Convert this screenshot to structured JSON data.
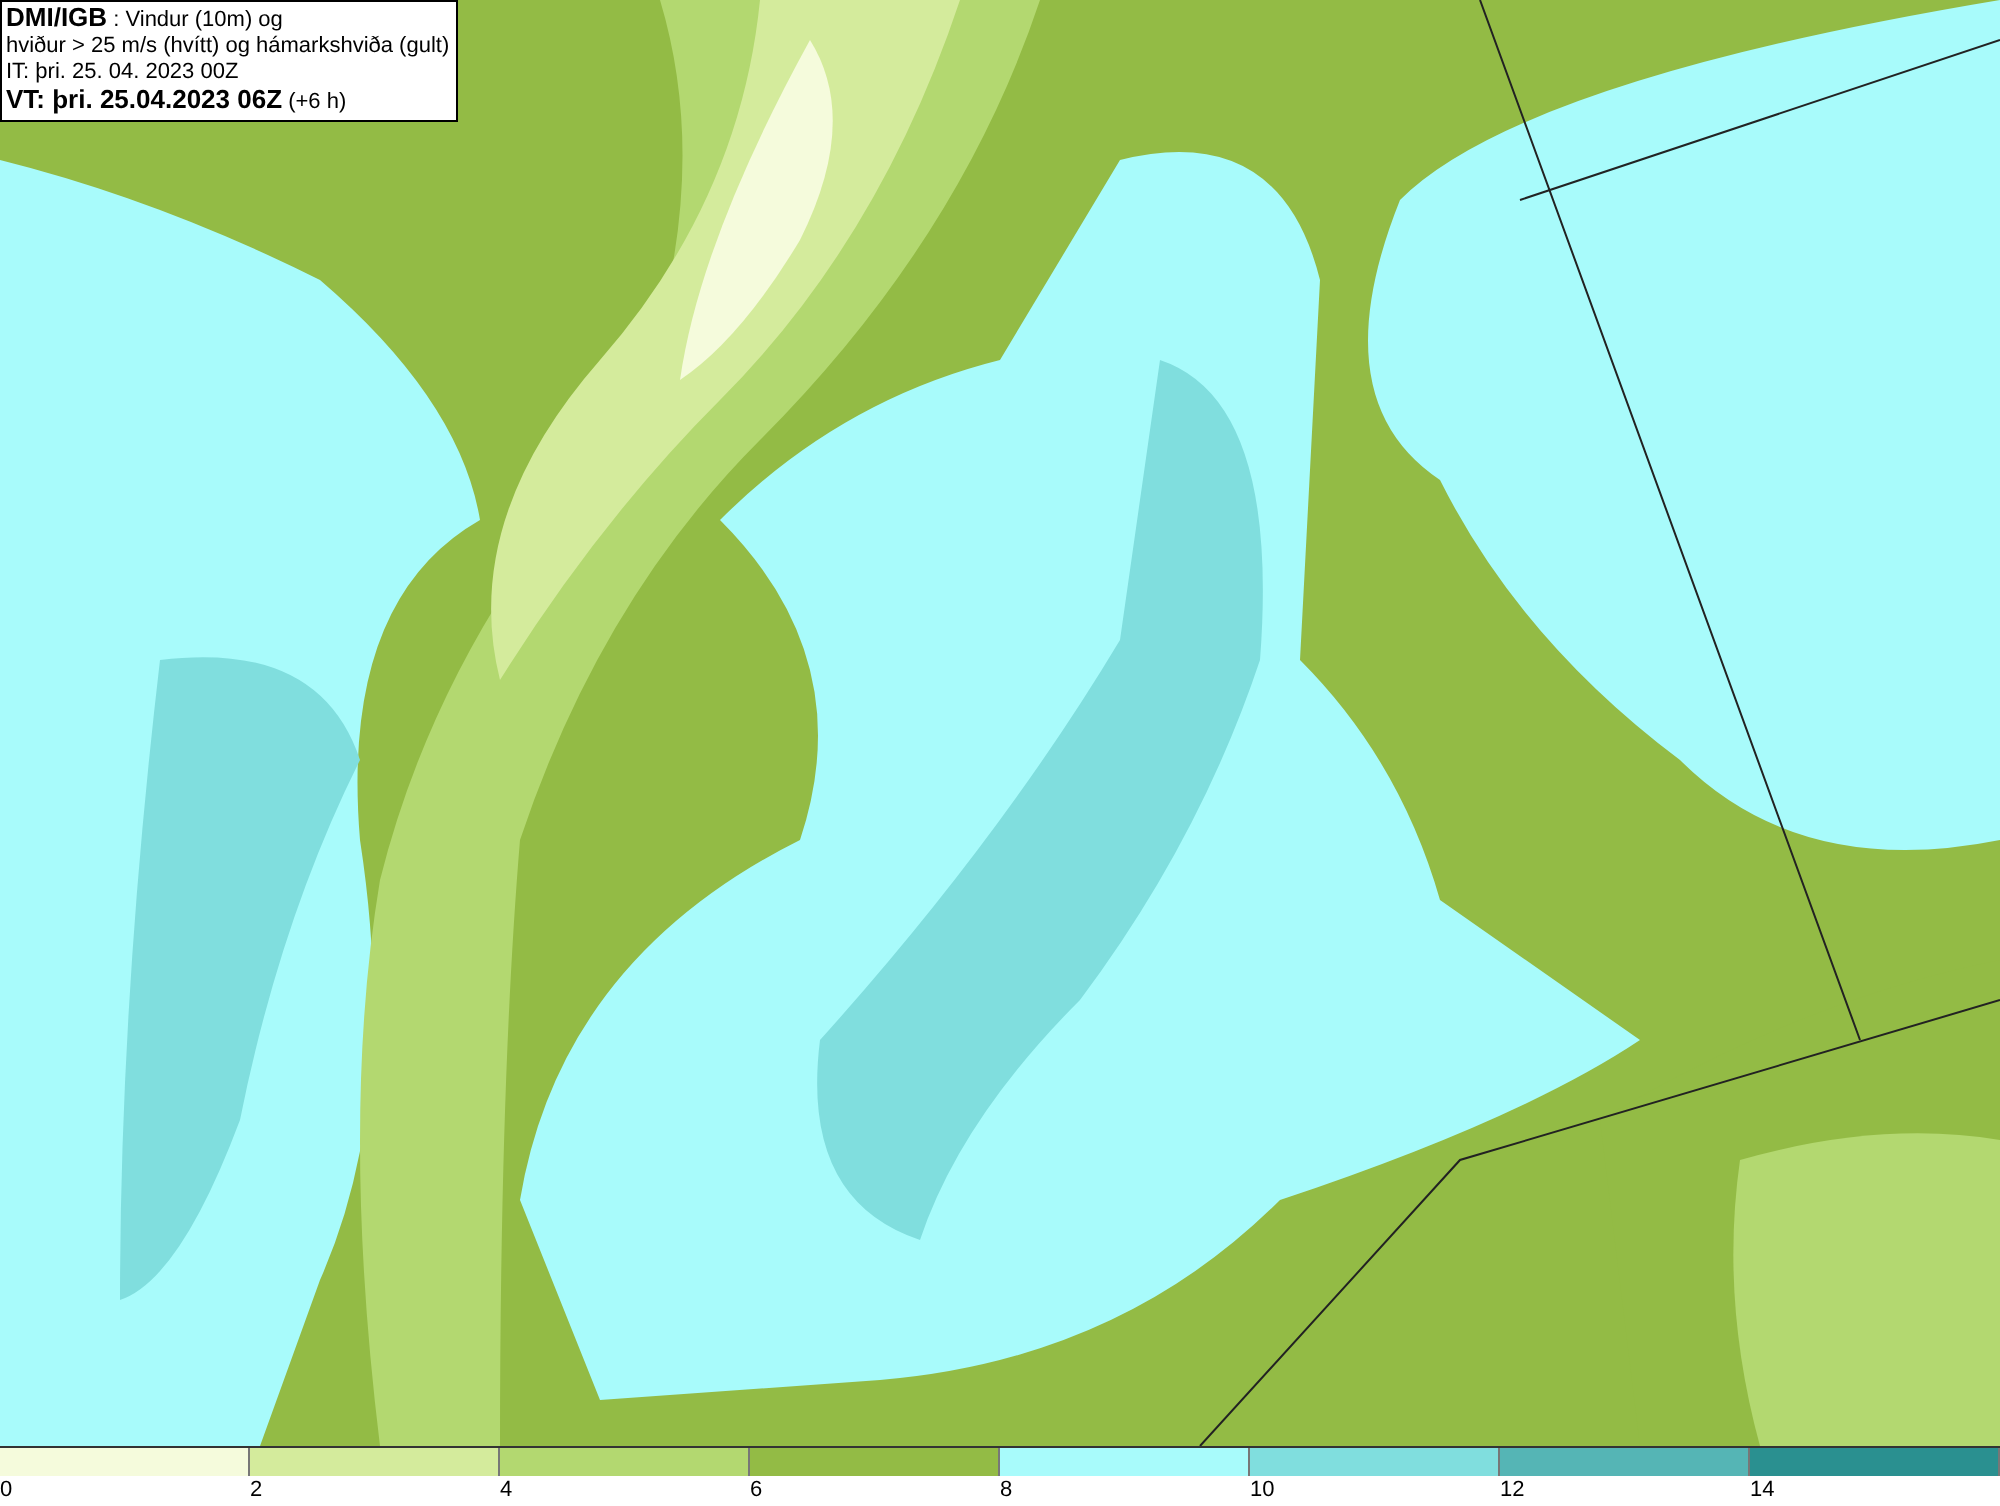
{
  "title_box": {
    "lines": [
      "**DMI/IGB** : Vindur (10m) og",
      "hviður > 25 m/s (hvítt) og hámarkshviða (gult)",
      "IT: þri. 25. 04. 2023 00Z",
      "**VT: þri. 25.04.2023 06Z** (+6 h)"
    ]
  },
  "legend": [
    {
      "label": "0",
      "color": "#f5fbdc"
    },
    {
      "label": "2",
      "color": "#d4eb9c"
    },
    {
      "label": "4",
      "color": "#b3d870"
    },
    {
      "label": "6",
      "color": "#93bb45"
    },
    {
      "label": "8",
      "color": "#a8fbfb"
    },
    {
      "label": "10",
      "color": "#80dede"
    },
    {
      "label": "12",
      "color": "#55b5b5"
    },
    {
      "label": "14",
      "color": "#2a9090"
    }
  ]
}
